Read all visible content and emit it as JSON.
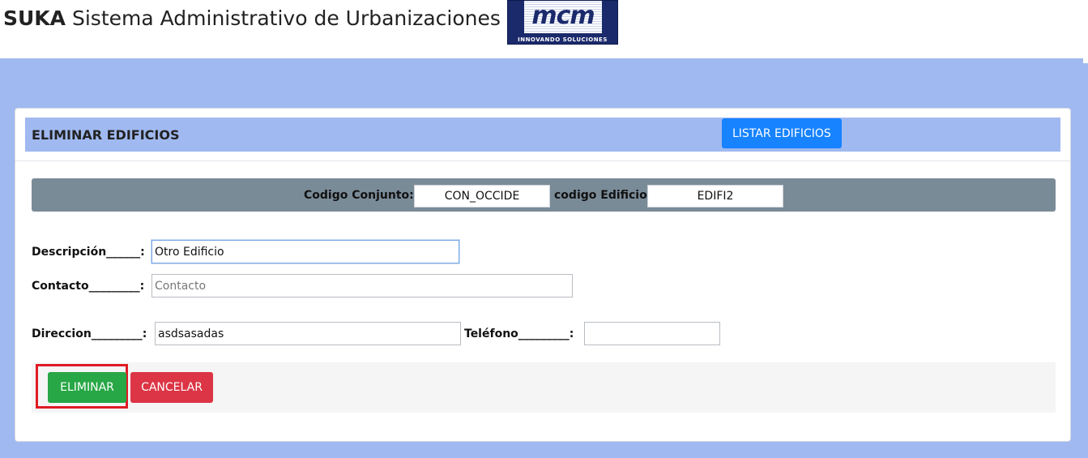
{
  "header": {
    "brand": "SUKA",
    "title": "Sistema Administrativo de Urbanizaciones",
    "logo_text": "mcm",
    "logo_subtext": "INNOVANDO SOLUCIONES"
  },
  "form": {
    "title": "ELIMINAR EDIFICIOS",
    "list_button_label": "LISTAR EDIFICIOS",
    "codes": {
      "conjunto_label": "Codigo Conjunto:",
      "conjunto_value": "CON_OCCIDE",
      "edificio_label": "codigo Edificio",
      "edificio_value": "EDIFI2"
    },
    "fields": {
      "descripcion_label": "Descripción______:",
      "descripcion_value": "Otro Edificio",
      "contacto_label": "Contacto_________:",
      "contacto_value": "",
      "contacto_placeholder": "Contacto",
      "direccion_label": "Direccion_________:",
      "direccion_value": "asdsasadas",
      "telefono_label": "Teléfono_________:",
      "telefono_value": ""
    },
    "actions": {
      "delete_label": "ELIMINAR",
      "cancel_label": "CANCELAR"
    }
  },
  "colors": {
    "header_band": "#a0b9f0",
    "code_bar": "#7a8b98",
    "list_button": "#1783ff",
    "delete_button": "#27a745",
    "cancel_button": "#dc3545",
    "highlight": "#e01b24"
  }
}
